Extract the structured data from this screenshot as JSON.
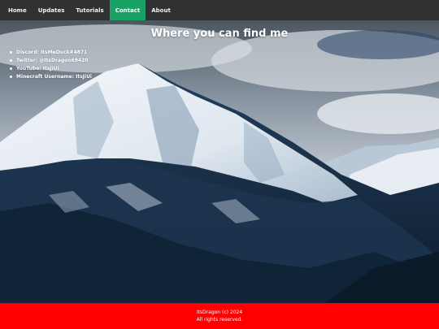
{
  "nav": {
    "items": [
      {
        "label": "Home"
      },
      {
        "label": "Updates"
      },
      {
        "label": "Tutorials"
      },
      {
        "label": "Contact"
      },
      {
        "label": "About"
      }
    ],
    "active_color": "#1aa165",
    "bar_color": "#2f3133"
  },
  "main": {
    "title": "Where you can find me",
    "contacts": [
      "Discord: ItsMeDuck#4871",
      "Twitter: @ItsDragon69420",
      "YouTube: ItsJiUi",
      "Minecraft Username: ItsJiUi"
    ],
    "background": "mountain-landscape"
  },
  "footer": {
    "copyright": "ItsDragon (c) 2024",
    "rights": "All rights reserved.",
    "color": "#ff0000"
  }
}
